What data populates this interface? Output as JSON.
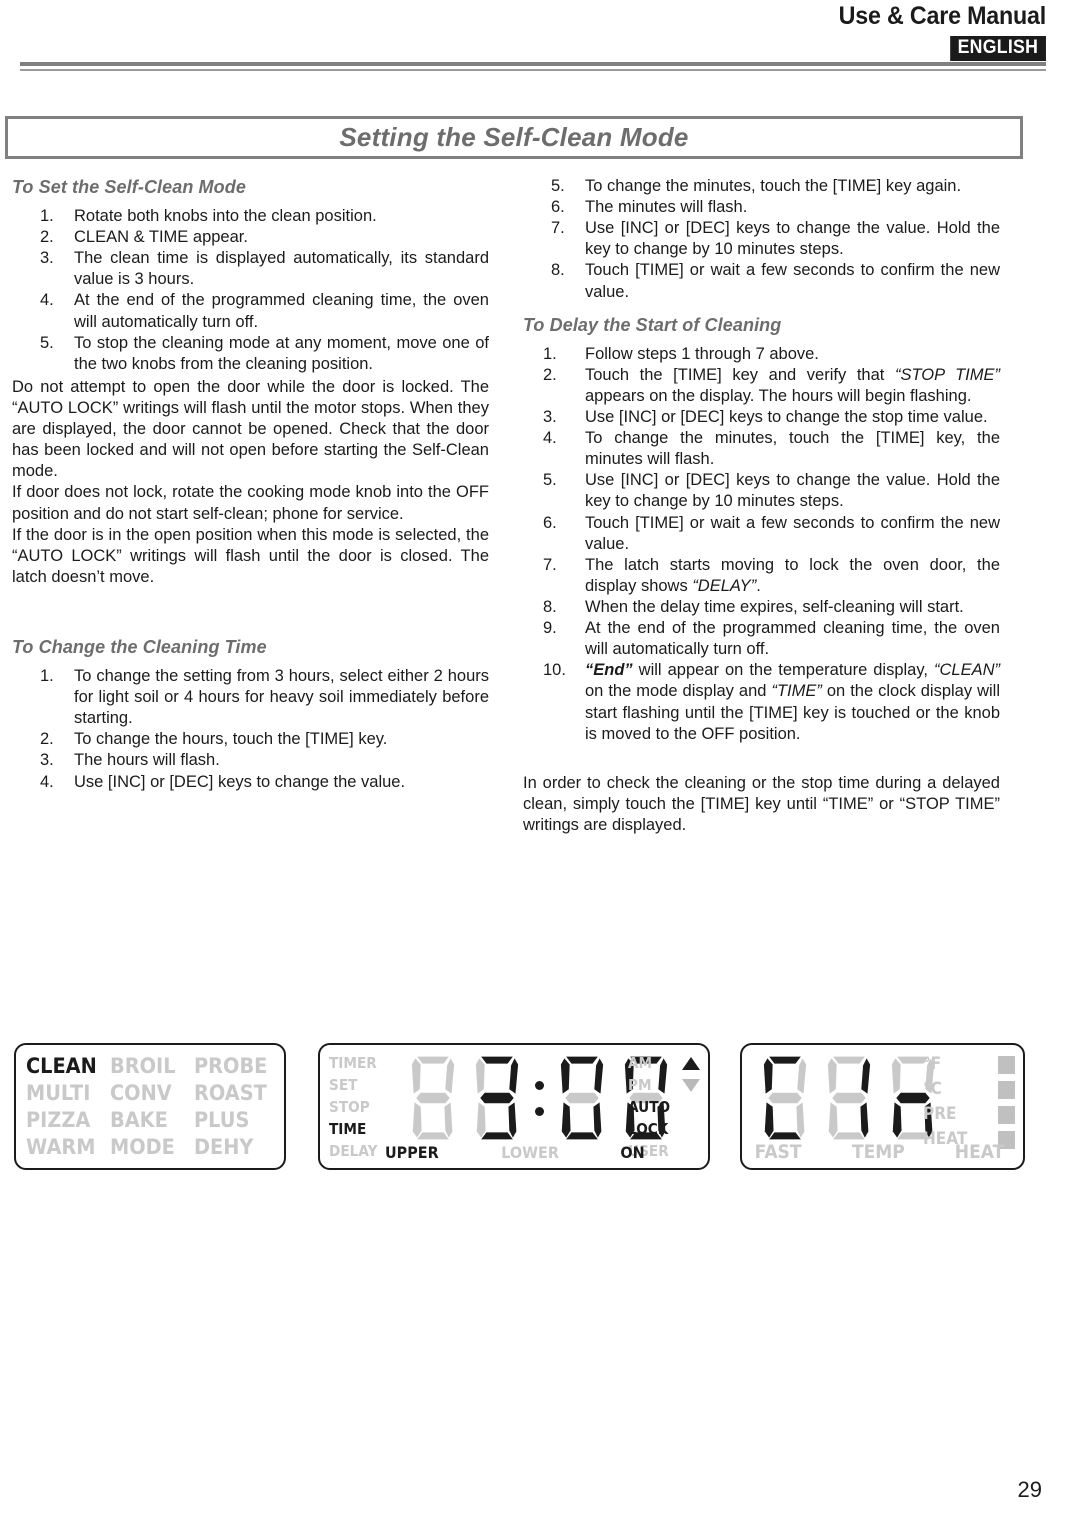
{
  "header": {
    "manual_title": "Use & Care Manual",
    "language_badge": "ENGLISH"
  },
  "banner": {
    "title": "Setting the Self-Clean Mode"
  },
  "left_column": {
    "section1_heading": "To Set the Self-Clean Mode",
    "section1_steps": [
      {
        "num": "1.",
        "text": "Rotate both knobs into the clean position."
      },
      {
        "num": "2.",
        "text": "CLEAN & TIME appear."
      },
      {
        "num": "3.",
        "text": "The clean time is displayed automatically, its standard value is 3 hours."
      },
      {
        "num": "4.",
        "text": "At the end of the programmed cleaning time, the oven will automatically turn off."
      },
      {
        "num": "5.",
        "text": "To stop the cleaning mode at any moment, move one of the two knobs from the cleaning position."
      }
    ],
    "note1": "Do not attempt to open the door while the door is locked. The “AUTO LOCK” writings will flash until the motor stops. When they are displayed, the door cannot be opened. Check that the door has been locked and will not open before starting the Self-Clean mode.",
    "note2": "If door does not lock, rotate the cooking mode knob into the OFF position and do not start self-clean; phone for service.",
    "note3": "If the door is in the open position when this mode is selected, the “AUTO LOCK” writings will flash until the door is closed. The latch doesn’t move.",
    "section2_heading": "To Change the Cleaning Time",
    "section2_steps": [
      {
        "num": "1.",
        "text": "To change the setting from 3 hours, select either 2 hours for light soil or 4 hours for heavy soil immediately before starting."
      },
      {
        "num": "2.",
        "text": "To change the hours, touch the [TIME] key."
      },
      {
        "num": "3.",
        "text": "The hours will flash."
      },
      {
        "num": "4.",
        "text": "Use [INC] or [DEC] keys to change the value."
      }
    ]
  },
  "right_column": {
    "continued_steps": [
      {
        "num": "5.",
        "text": "To change the minutes, touch the [TIME] key again."
      },
      {
        "num": "6.",
        "text": "The minutes will flash."
      },
      {
        "num": "7.",
        "text": "Use [INC] or [DEC] keys to change the value. Hold the key to change by 10 minutes steps."
      },
      {
        "num": "8.",
        "text": "Touch [TIME] or wait a few seconds to confirm the new value."
      }
    ],
    "section3_heading": "To Delay the Start of Cleaning",
    "section3_steps": [
      {
        "num": "1.",
        "text": "Follow steps 1 through 7 above."
      },
      {
        "num": "2.",
        "text": "Touch the [TIME] key and verify that “STOP TIME” appears on the display. The hours will begin flashing.",
        "italic_part": "“STOP TIME”"
      },
      {
        "num": "3.",
        "text": "Use [INC] or [DEC] keys to change the stop time value."
      },
      {
        "num": "4.",
        "text": "To change the minutes, touch the [TIME] key, the minutes will flash."
      },
      {
        "num": "5.",
        "text": "Use [INC] or [DEC] keys to change the value. Hold the key to change by 10 minutes steps."
      },
      {
        "num": "6.",
        "text": "Touch [TIME] or wait a few seconds to confirm the new value."
      },
      {
        "num": "7.",
        "text": "The latch starts moving to lock the oven door, the display shows “DELAY”.",
        "italic_part": "“DELAY”"
      },
      {
        "num": "8.",
        "text": "When the delay time expires, self-cleaning will start."
      },
      {
        "num": "9.",
        "text": "At the end of the programmed cleaning time, the oven will automatically turn off."
      },
      {
        "num": "10.",
        "text": "“End” will appear on the temperature display, “CLEAN” on the mode display and “TIME” on the clock display will start flashing until the [TIME] key is touched or the knob is moved to the OFF position."
      }
    ],
    "closing_note": "In order to check the cleaning or the stop time during a delayed clean, simply touch the [TIME] key until “TIME” or “STOP TIME” writings are displayed."
  },
  "displays": {
    "mode_panel": {
      "items": [
        {
          "label": "CLEAN",
          "state": "on"
        },
        {
          "label": "BROIL",
          "state": "off"
        },
        {
          "label": "PROBE",
          "state": "off"
        },
        {
          "label": "MULTI",
          "state": "off"
        },
        {
          "label": "CONV",
          "state": "off"
        },
        {
          "label": "ROAST",
          "state": "off"
        },
        {
          "label": "PIZZA",
          "state": "off"
        },
        {
          "label": "BAKE",
          "state": "off"
        },
        {
          "label": "PLUS",
          "state": "off"
        },
        {
          "label": "WARM",
          "state": "off"
        },
        {
          "label": "MODE",
          "state": "off"
        },
        {
          "label": "DEHY",
          "state": "off"
        }
      ]
    },
    "clock_panel": {
      "left_indicators": [
        {
          "label": "TIMER",
          "state": "off"
        },
        {
          "label": "SET",
          "state": "off"
        },
        {
          "label": "STOP",
          "state": "off"
        },
        {
          "label": "TIME",
          "state": "on"
        },
        {
          "label": "DELAY",
          "state": "off"
        }
      ],
      "right_indicators": [
        {
          "label": "AM",
          "state": "off",
          "arrow": "up",
          "arrow_state": "on"
        },
        {
          "label": "PM",
          "state": "off",
          "arrow": "down",
          "arrow_state": "off"
        },
        {
          "label": "AUTO",
          "state": "on"
        },
        {
          "label": "LOCK",
          "state": "on"
        },
        {
          "label": "USER",
          "state": "off"
        }
      ],
      "bottom_indicators": [
        {
          "label": "UPPER",
          "state": "on"
        },
        {
          "label": "LOWER",
          "state": "off"
        },
        {
          "label": "ON",
          "state": "on"
        }
      ],
      "reading": "3:00",
      "digits": [
        {
          "char": "",
          "segments": ""
        },
        {
          "char": "3",
          "segments": "a,b,c,d,g"
        },
        {
          "char": "0",
          "segments": "a,b,c,d,e,f"
        },
        {
          "char": "0",
          "segments": "a,b,c,d,e,f"
        }
      ],
      "colon": "on"
    },
    "temp_panel": {
      "reading": "C1n",
      "digits": [
        {
          "char": "C",
          "segments": "a,d,e,f"
        },
        {
          "char": "1",
          "segments": "b,c"
        },
        {
          "char": "n",
          "segments": "c,e,g"
        }
      ],
      "right_indicators": [
        {
          "label": "°F",
          "state": "off",
          "bar": "on"
        },
        {
          "label": "°C",
          "state": "off",
          "bar": "on"
        },
        {
          "label": "PRE",
          "state": "off",
          "bar": "on"
        },
        {
          "label": "HEAT",
          "state": "off",
          "bar": "on"
        }
      ],
      "right_labels_split": [
        {
          "label": "°F",
          "state": "off"
        },
        {
          "label": "°C",
          "state": "off"
        },
        {
          "label": "PRE",
          "state": "off"
        },
        {
          "label": "HEAT",
          "state": "off"
        }
      ],
      "bottom_indicators": [
        {
          "label": "FAST",
          "state": "off"
        },
        {
          "label": "TEMP",
          "state": "off"
        },
        {
          "label": "HEAT",
          "state": "off"
        }
      ]
    }
  },
  "footer": {
    "page_number": "29"
  },
  "colors": {
    "text": "#1b1b1b",
    "heading_gray": "#6d6d6d",
    "lcd_off": "#c9c9c9",
    "rule_gray": "#808080"
  }
}
